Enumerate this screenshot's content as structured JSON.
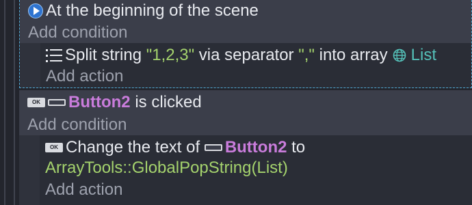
{
  "events": [
    {
      "condition": "At the beginning of the scene",
      "add_condition": "Add condition",
      "action": {
        "prefix": "Split string ",
        "string_value": "\"1,2,3\"",
        "middle": " via separator ",
        "separator_value": "\",\"",
        "suffix": " into array",
        "array_name": "List"
      },
      "add_action": "Add action"
    },
    {
      "condition": {
        "object": "Button2",
        "text": " is clicked"
      },
      "add_condition": "Add condition",
      "action": {
        "prefix": "Change the text of ",
        "object": "Button2",
        "to": " to",
        "expression": "ArrayTools::GlobalPopString(List)"
      },
      "add_action": "Add action"
    }
  ],
  "icons": {
    "scene_start": "play-circle-icon",
    "split_string": "list-icon",
    "global_variable": "globe-icon",
    "button_event": "ok-button-icon",
    "button_object": "button-object-icon"
  },
  "colors": {
    "background": "#23252d",
    "condition_bg": "#3b3e4a",
    "action_bg": "#2a2d36",
    "param_green": "#a5d36d",
    "variable_teal": "#54c0b8",
    "object_purple": "#c97cdb",
    "muted_text": "#9ea2ae",
    "selection_border": "#4fa7d2"
  }
}
